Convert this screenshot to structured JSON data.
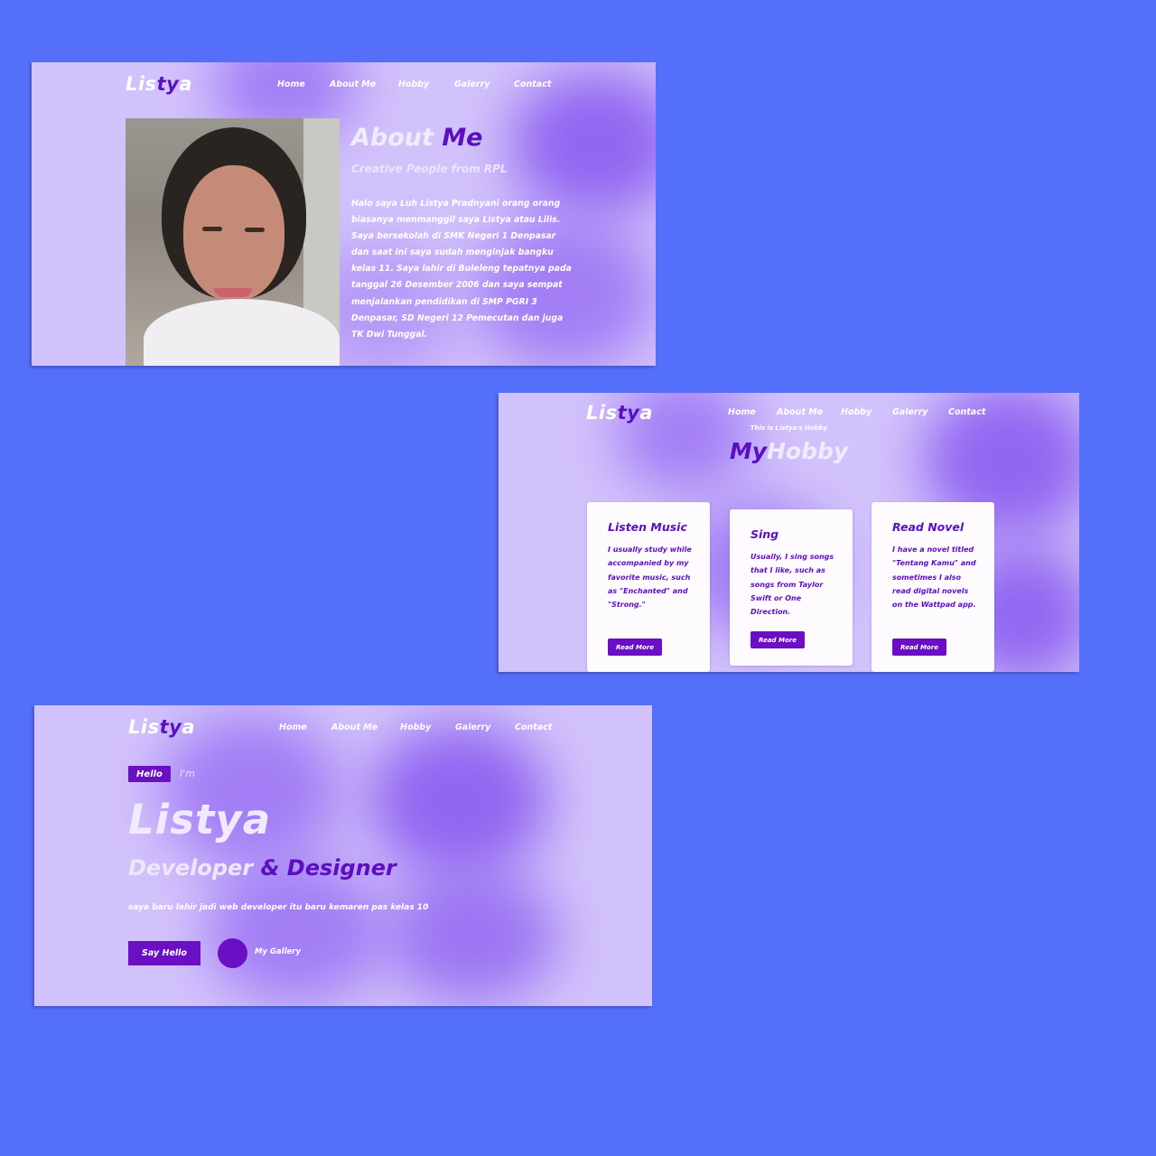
{
  "logo": {
    "part1": "Lis",
    "part2": "ty",
    "part3": "a"
  },
  "nav": {
    "home": "Home",
    "about": "About Me",
    "hobby": "Hobby",
    "gallery": "Galerry",
    "contact": "Contact"
  },
  "about": {
    "title_light": "About",
    "title_dark": "Me",
    "subtitle": "Creative People from RPL",
    "body": "Halo saya Luh Listya Pradnyani orang orang biasanya menmanggil saya Listya atau Lilis. Saya bersekolah di SMK Negeri 1 Denpasar dan saat ini saya sudah menginjak bangku kelas 11. Saya lahir di Buleleng tepatnya pada tanggal 26 Desember 2006 dan saya sempat menjalankan pendidikan di SMP PGRI 3 Denpasar, SD Negeri 12 Pemecutan dan juga TK Dwi Tunggal."
  },
  "hobby": {
    "kicker": "This is Listya's Hobby",
    "title_dark": "My",
    "title_light": "Hobby",
    "cards": [
      {
        "title": "Listen Music",
        "text": "I usually study while accompanied by my favorite music, such as \"Enchanted\" and \"Strong.\"",
        "button": "Read More"
      },
      {
        "title": "Sing",
        "text": "Usually, I sing songs that I like, such as songs from Taylor Swift or One Direction.",
        "button": "Read More"
      },
      {
        "title": "Read Novel",
        "text": "I have a novel titled \"Tentang Kamu\" and sometimes I also read digital novels on the Wattpad app.",
        "button": "Read More"
      }
    ]
  },
  "hero": {
    "badge": "Hello",
    "im": "I'm",
    "name": "Listya",
    "role_light": "Developer",
    "role_dark": " & Designer",
    "tagline": "saya baru lahir jadi web developer itu baru kemaren pas kelas 10",
    "button": "Say Hello",
    "gallery_link": "My Gallery"
  },
  "colors": {
    "background": "#5470fb",
    "panel": "#d2c2fb",
    "accent": "#6a0fc4",
    "accent_text": "#5b0fbf"
  }
}
